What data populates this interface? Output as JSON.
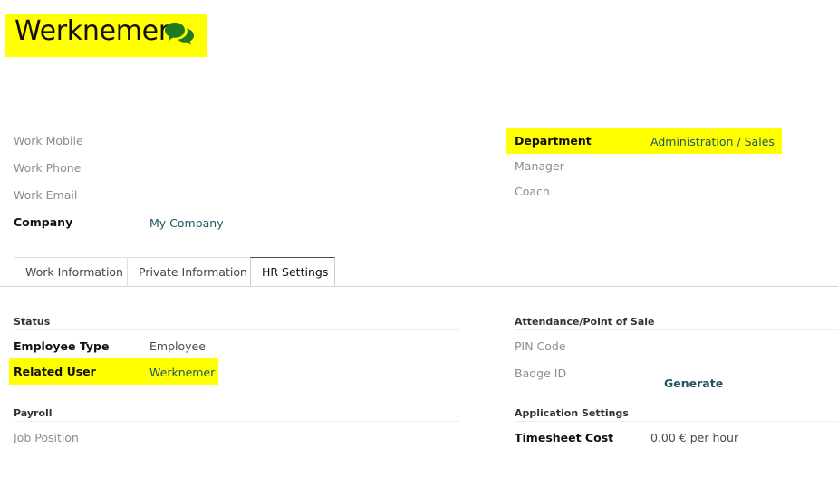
{
  "header": {
    "title": "Werknemer",
    "chat_icon": "chat-bubbles-icon",
    "icon_color": "#1f7a1f"
  },
  "left_fields": {
    "work_mobile": "Work Mobile",
    "work_phone": "Work Phone",
    "work_email": "Work Email",
    "company_label": "Company",
    "company_value": "My Company"
  },
  "right_fields": {
    "department_label": "Department",
    "department_value": "Administration / Sales",
    "manager": "Manager",
    "coach": "Coach"
  },
  "tabs": [
    {
      "label": "Work Information",
      "active": false
    },
    {
      "label": "Private Information",
      "active": false
    },
    {
      "label": "HR Settings",
      "active": true
    }
  ],
  "hr_settings": {
    "status_section": "Status",
    "employee_type_label": "Employee Type",
    "employee_type_value": "Employee",
    "related_user_label": "Related User",
    "related_user_value": "Werknemer",
    "payroll_section": "Payroll",
    "job_position": "Job Position",
    "attendance_section": "Attendance/Point of Sale",
    "pin_code": "PIN Code",
    "badge_id": "Badge ID",
    "generate_label": "Generate",
    "application_section": "Application Settings",
    "timesheet_cost_label": "Timesheet Cost",
    "timesheet_cost_value": "0.00 € per hour"
  },
  "colors": {
    "highlight": "#ffff00",
    "link": "#1f5561",
    "tab_active_border": "#5b3e5d"
  }
}
